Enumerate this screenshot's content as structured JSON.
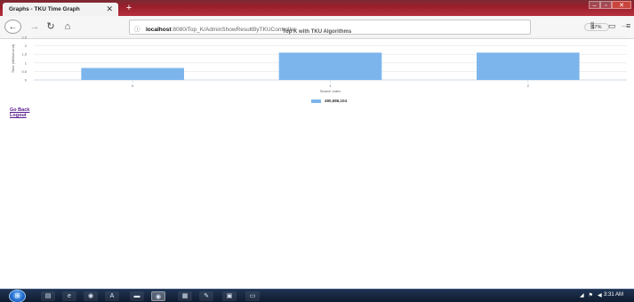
{
  "browser": {
    "tab_title": "Graphs - TKU Time Graph",
    "tab_close": "✕",
    "new_tab": "+",
    "url_host": "localhost",
    "url_path": ":8080/Top_K/AdminShowResultByTKUController",
    "zoom": "67%",
    "nav_icons": [
      "back-arrow-icon",
      "forward-arrow-icon",
      "reload-icon",
      "home-icon"
    ],
    "window_controls": [
      "minimize",
      "maximize",
      "close"
    ],
    "accent_color": "#b7313f"
  },
  "chart_data": {
    "type": "bar",
    "title": "Top K with TKU Algorithms",
    "xlabel": "Search Index",
    "ylabel": "Time (Millisecond)",
    "categories": [
      "0",
      "1",
      "2"
    ],
    "series": [
      {
        "name": "490,586,104",
        "values": [
          0.7,
          1.6,
          1.6
        ],
        "color": "#7cb5ec"
      }
    ],
    "ylim": [
      0,
      2.5
    ],
    "yticks": [
      "0",
      "0.5",
      "1",
      "1.5",
      "2",
      "2.5"
    ],
    "grid": true,
    "legend_position": "bottom-center"
  },
  "links": {
    "go_back": "Go Back",
    "logout": "Logout"
  },
  "taskbar": {
    "clock": "3:31 AM",
    "apps": [
      "explorer",
      "ie",
      "firefox",
      "acrobat",
      "app",
      "media",
      "explorer2",
      "paint",
      "vlc",
      "remote"
    ]
  }
}
